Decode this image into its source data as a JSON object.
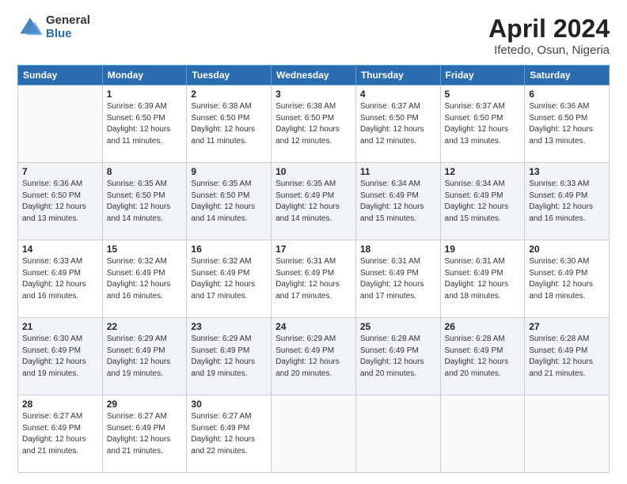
{
  "header": {
    "logo": {
      "general": "General",
      "blue": "Blue"
    },
    "title": "April 2024",
    "subtitle": "Ifetedo, Osun, Nigeria"
  },
  "weekdays": [
    "Sunday",
    "Monday",
    "Tuesday",
    "Wednesday",
    "Thursday",
    "Friday",
    "Saturday"
  ],
  "weeks": [
    [
      {
        "day": "",
        "info": ""
      },
      {
        "day": "1",
        "info": "Sunrise: 6:39 AM\nSunset: 6:50 PM\nDaylight: 12 hours\nand 11 minutes."
      },
      {
        "day": "2",
        "info": "Sunrise: 6:38 AM\nSunset: 6:50 PM\nDaylight: 12 hours\nand 11 minutes."
      },
      {
        "day": "3",
        "info": "Sunrise: 6:38 AM\nSunset: 6:50 PM\nDaylight: 12 hours\nand 12 minutes."
      },
      {
        "day": "4",
        "info": "Sunrise: 6:37 AM\nSunset: 6:50 PM\nDaylight: 12 hours\nand 12 minutes."
      },
      {
        "day": "5",
        "info": "Sunrise: 6:37 AM\nSunset: 6:50 PM\nDaylight: 12 hours\nand 13 minutes."
      },
      {
        "day": "6",
        "info": "Sunrise: 6:36 AM\nSunset: 6:50 PM\nDaylight: 12 hours\nand 13 minutes."
      }
    ],
    [
      {
        "day": "7",
        "info": "Sunrise: 6:36 AM\nSunset: 6:50 PM\nDaylight: 12 hours\nand 13 minutes."
      },
      {
        "day": "8",
        "info": "Sunrise: 6:35 AM\nSunset: 6:50 PM\nDaylight: 12 hours\nand 14 minutes."
      },
      {
        "day": "9",
        "info": "Sunrise: 6:35 AM\nSunset: 6:50 PM\nDaylight: 12 hours\nand 14 minutes."
      },
      {
        "day": "10",
        "info": "Sunrise: 6:35 AM\nSunset: 6:49 PM\nDaylight: 12 hours\nand 14 minutes."
      },
      {
        "day": "11",
        "info": "Sunrise: 6:34 AM\nSunset: 6:49 PM\nDaylight: 12 hours\nand 15 minutes."
      },
      {
        "day": "12",
        "info": "Sunrise: 6:34 AM\nSunset: 6:49 PM\nDaylight: 12 hours\nand 15 minutes."
      },
      {
        "day": "13",
        "info": "Sunrise: 6:33 AM\nSunset: 6:49 PM\nDaylight: 12 hours\nand 16 minutes."
      }
    ],
    [
      {
        "day": "14",
        "info": "Sunrise: 6:33 AM\nSunset: 6:49 PM\nDaylight: 12 hours\nand 16 minutes."
      },
      {
        "day": "15",
        "info": "Sunrise: 6:32 AM\nSunset: 6:49 PM\nDaylight: 12 hours\nand 16 minutes."
      },
      {
        "day": "16",
        "info": "Sunrise: 6:32 AM\nSunset: 6:49 PM\nDaylight: 12 hours\nand 17 minutes."
      },
      {
        "day": "17",
        "info": "Sunrise: 6:31 AM\nSunset: 6:49 PM\nDaylight: 12 hours\nand 17 minutes."
      },
      {
        "day": "18",
        "info": "Sunrise: 6:31 AM\nSunset: 6:49 PM\nDaylight: 12 hours\nand 17 minutes."
      },
      {
        "day": "19",
        "info": "Sunrise: 6:31 AM\nSunset: 6:49 PM\nDaylight: 12 hours\nand 18 minutes."
      },
      {
        "day": "20",
        "info": "Sunrise: 6:30 AM\nSunset: 6:49 PM\nDaylight: 12 hours\nand 18 minutes."
      }
    ],
    [
      {
        "day": "21",
        "info": "Sunrise: 6:30 AM\nSunset: 6:49 PM\nDaylight: 12 hours\nand 19 minutes."
      },
      {
        "day": "22",
        "info": "Sunrise: 6:29 AM\nSunset: 6:49 PM\nDaylight: 12 hours\nand 19 minutes."
      },
      {
        "day": "23",
        "info": "Sunrise: 6:29 AM\nSunset: 6:49 PM\nDaylight: 12 hours\nand 19 minutes."
      },
      {
        "day": "24",
        "info": "Sunrise: 6:29 AM\nSunset: 6:49 PM\nDaylight: 12 hours\nand 20 minutes."
      },
      {
        "day": "25",
        "info": "Sunrise: 6:28 AM\nSunset: 6:49 PM\nDaylight: 12 hours\nand 20 minutes."
      },
      {
        "day": "26",
        "info": "Sunrise: 6:28 AM\nSunset: 6:49 PM\nDaylight: 12 hours\nand 20 minutes."
      },
      {
        "day": "27",
        "info": "Sunrise: 6:28 AM\nSunset: 6:49 PM\nDaylight: 12 hours\nand 21 minutes."
      }
    ],
    [
      {
        "day": "28",
        "info": "Sunrise: 6:27 AM\nSunset: 6:49 PM\nDaylight: 12 hours\nand 21 minutes."
      },
      {
        "day": "29",
        "info": "Sunrise: 6:27 AM\nSunset: 6:49 PM\nDaylight: 12 hours\nand 21 minutes."
      },
      {
        "day": "30",
        "info": "Sunrise: 6:27 AM\nSunset: 6:49 PM\nDaylight: 12 hours\nand 22 minutes."
      },
      {
        "day": "",
        "info": ""
      },
      {
        "day": "",
        "info": ""
      },
      {
        "day": "",
        "info": ""
      },
      {
        "day": "",
        "info": ""
      }
    ]
  ]
}
